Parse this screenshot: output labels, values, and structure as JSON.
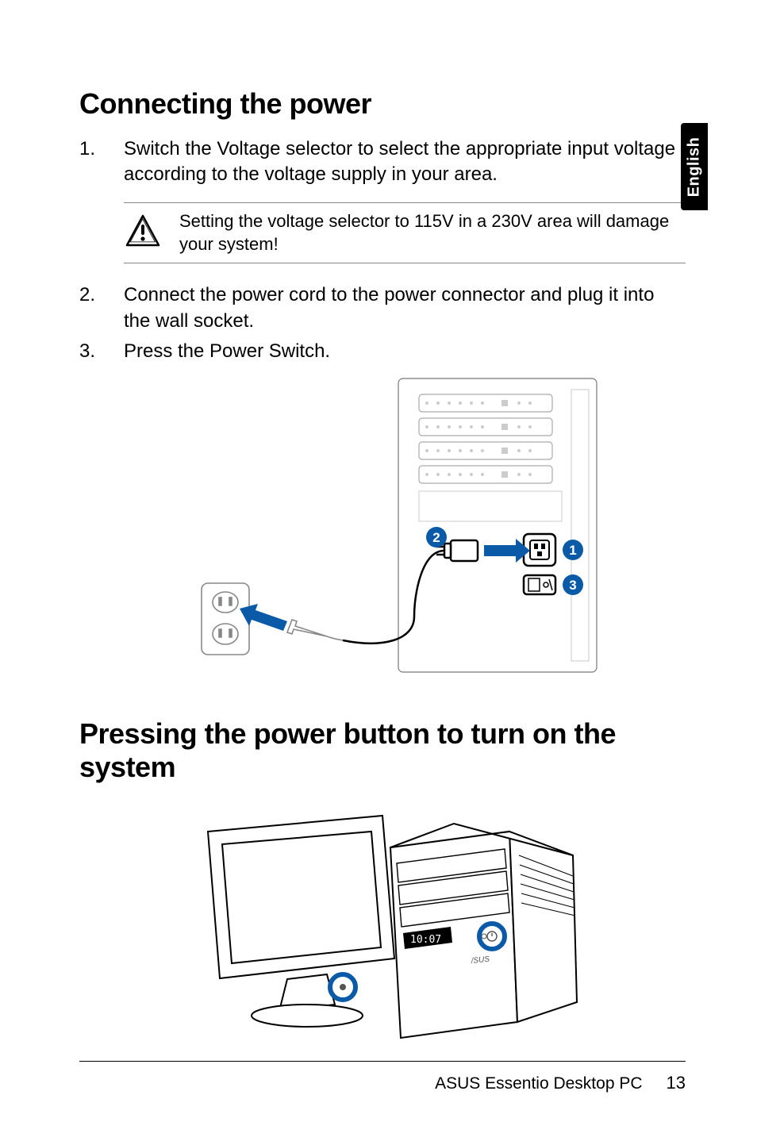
{
  "sideTab": "English",
  "heading1": "Connecting the power",
  "steps1": [
    {
      "num": "1.",
      "text": "Switch the Voltage selector to select the appropriate input voltage according to the voltage supply in your area."
    }
  ],
  "warning": "Setting the voltage selector to 115V in a 230V area will damage your system!",
  "steps1b": [
    {
      "num": "2.",
      "text": "Connect the power cord to the power connector and plug  it into the wall socket."
    },
    {
      "num": "3.",
      "text": "Press the Power Switch."
    }
  ],
  "callouts": {
    "c1": "1",
    "c2": "2",
    "c3": "3"
  },
  "heading2": "Pressing the power button to turn on the system",
  "fig2_time": "10:07",
  "footer_title": "ASUS Essentio Desktop PC",
  "footer_page": "13"
}
